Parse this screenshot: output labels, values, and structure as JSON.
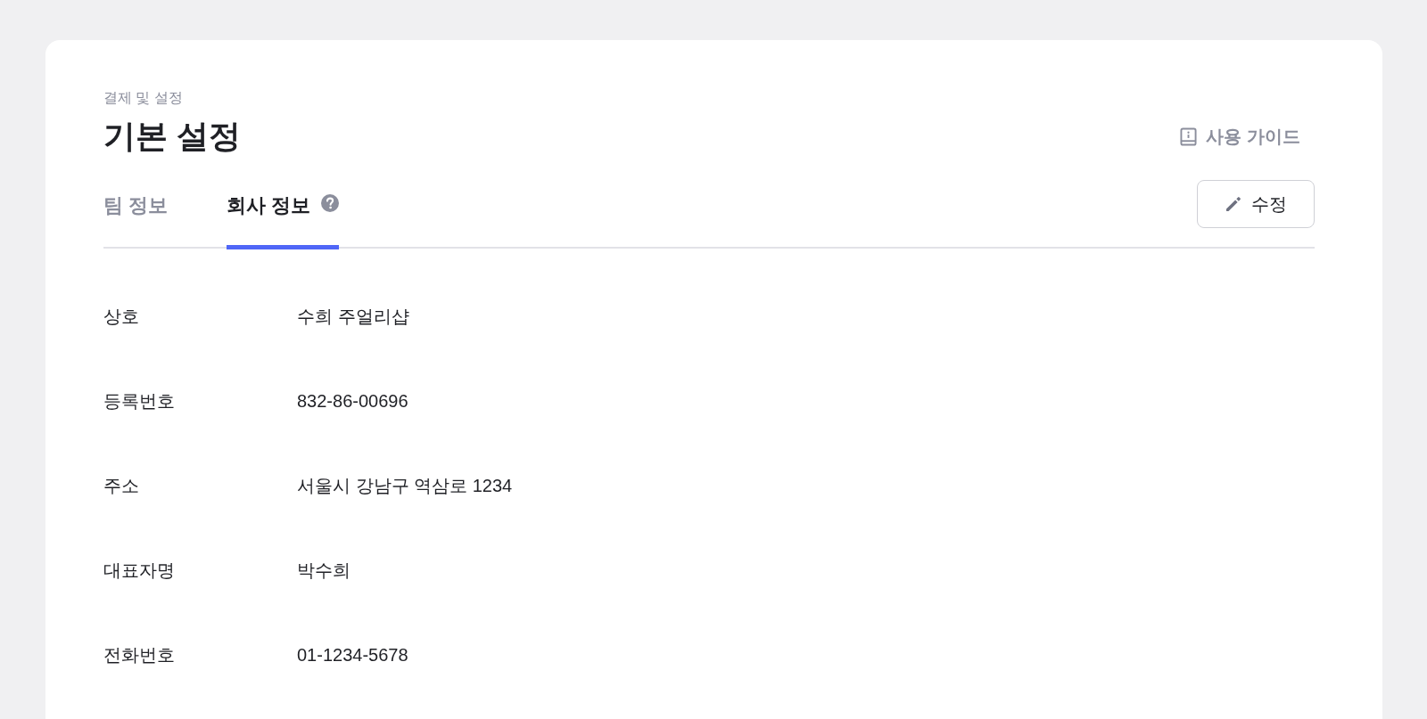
{
  "breadcrumb": "결제 및 설정",
  "title": "기본 설정",
  "guide_link": {
    "label": "사용 가이드"
  },
  "tabs": [
    {
      "label": "팀 정보",
      "selected": false,
      "help": false
    },
    {
      "label": "회사 정보",
      "selected": true,
      "help": true
    }
  ],
  "edit_button": {
    "label": "수정"
  },
  "fields": [
    {
      "label": "상호",
      "value": "수희 주얼리샵"
    },
    {
      "label": "등록번호",
      "value": "832-86-00696"
    },
    {
      "label": "주소",
      "value": "서울시 강남구 역삼로 1234"
    },
    {
      "label": "대표자명",
      "value": "박수희"
    },
    {
      "label": "전화번호",
      "value": "01-1234-5678"
    }
  ]
}
